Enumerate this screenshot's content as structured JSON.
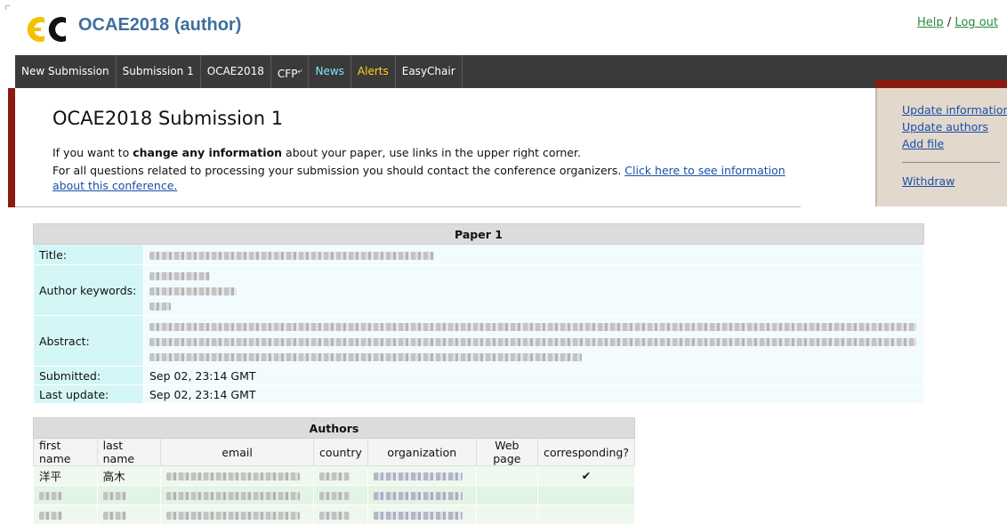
{
  "header": {
    "title": "OCAE2018 (author)",
    "help_label": "Help",
    "separator": "/",
    "logout_label": "Log out"
  },
  "menu": {
    "items": [
      {
        "label": "New Submission"
      },
      {
        "label": "Submission 1"
      },
      {
        "label": "OCAE2018"
      },
      {
        "label": "CFP"
      },
      {
        "label": "News"
      },
      {
        "label": "Alerts"
      },
      {
        "label": "EasyChair"
      }
    ]
  },
  "main": {
    "page_title": "OCAE2018 Submission 1",
    "info1_prefix": "If you want to ",
    "info1_bold": "change any information",
    "info1_suffix": " about your paper, use links in the upper right corner.",
    "info2_text": "For all questions related to processing your submission you should contact the conference organizers. ",
    "info2_link": "Click here to see information about this conference."
  },
  "right_panel": {
    "update_information": "Update information",
    "update_authors": "Update authors",
    "add_file": "Add file",
    "withdraw": "Withdraw"
  },
  "paper": {
    "caption": "Paper 1",
    "labels": {
      "title": "Title:",
      "keywords": "Author keywords:",
      "abstract": "Abstract:",
      "submitted": "Submitted:",
      "last_update": "Last update:"
    },
    "submitted": "Sep 02, 23:14 GMT",
    "last_update": "Sep 02, 23:14 GMT"
  },
  "authors": {
    "caption": "Authors",
    "columns": [
      "first name",
      "last name",
      "email",
      "country",
      "organization",
      "Web page",
      "corresponding?"
    ],
    "rows": [
      {
        "first_name": "洋平",
        "last_name": "高木",
        "corresponding": "✔"
      }
    ]
  },
  "colors": {
    "menu_bg": "#3a3a3a",
    "news": "#7fe3ff",
    "alerts": "#ffd21a",
    "accent_red": "#8b1a10",
    "title_blue": "#3f6f9e"
  }
}
